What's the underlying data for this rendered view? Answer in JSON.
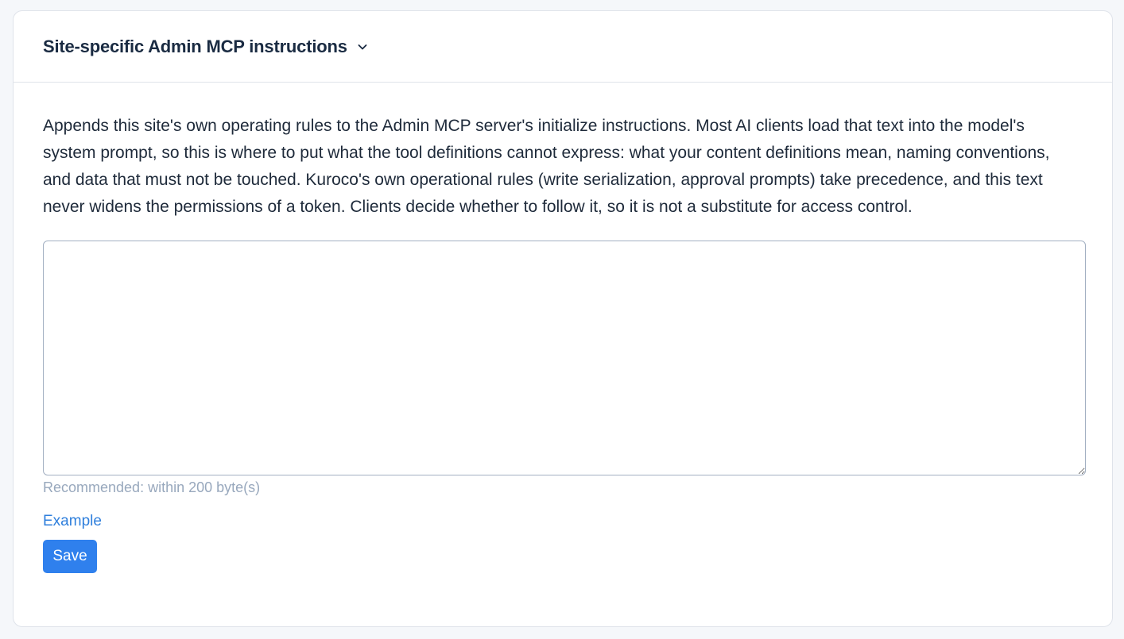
{
  "panel": {
    "title": "Site-specific Admin MCP instructions",
    "toggle_icon": "chevron-down-icon"
  },
  "description": "Appends this site's own operating rules to the Admin MCP server's initialize instructions. Most AI clients load that text into the model's system prompt, so this is where to put what the tool definitions cannot express: what your content definitions mean, naming conventions, and data that must not be touched. Kuroco's own operational rules (write serialization, approval prompts) take precedence, and this text never widens the permissions of a token. Clients decide whether to follow it, so it is not a substitute for access control.",
  "instructions_field": {
    "value": "",
    "placeholder": ""
  },
  "hint": "Recommended: within 200 byte(s)",
  "example_link": "Example",
  "save_label": "Save",
  "colors": {
    "accent": "#2f80ed",
    "link": "#2f7fdc",
    "hint": "#98a8bd",
    "border": "#dfe3ea"
  }
}
